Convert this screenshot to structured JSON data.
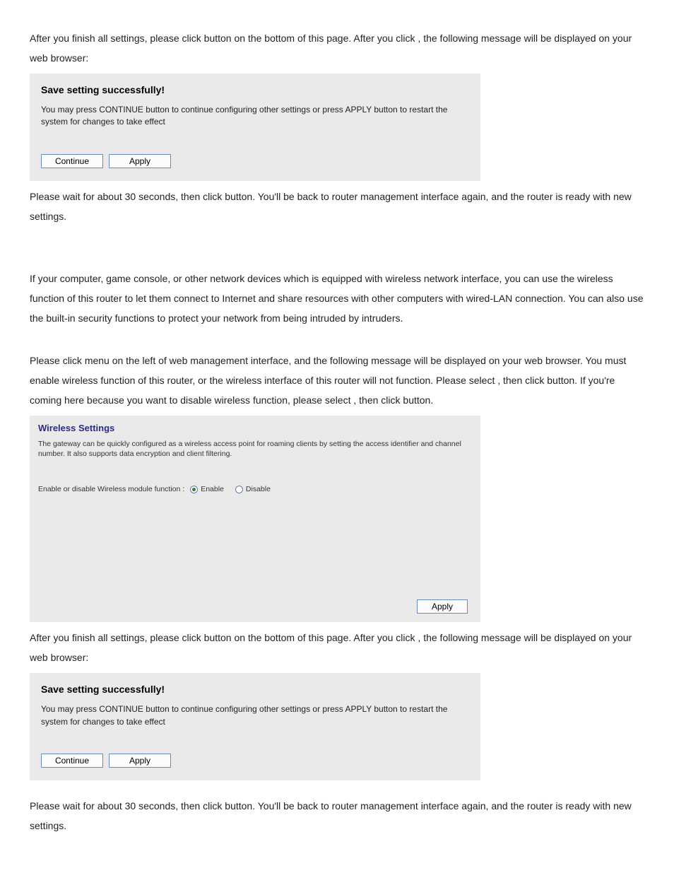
{
  "para1a": "After you finish all settings, please click ",
  "para1b": " button on the bottom of this page. After you click ",
  "para1c": ", the following message will be displayed on your web browser:",
  "dialog1": {
    "title": "Save setting successfully!",
    "desc": "You may press CONTINUE button to continue configuring other settings or press APPLY button to restart the system for changes to take effect",
    "continue": "Continue",
    "apply": "Apply"
  },
  "para2a": "Please wait for about 30 seconds, then click ",
  "para2b": " button. You'll be back to router management interface again, and the router is ready with new settings.",
  "para3": "If your computer, game console, or other network devices which is equipped with wireless network interface, you can use the wireless function of this router to let them connect to Internet and share resources with other computers with wired-LAN connection. You can also use the built-in security functions to protect your network from being intruded by intruders.",
  "para4a": "Please click ",
  "para4b": " menu on the left of web management interface, and the following message will be displayed on your web browser. You must enable wireless function of this router, or the wireless interface of this router will not function. Please select ",
  "para4c": ", then click ",
  "para4d": " button. If you're coming here because you want to disable wireless function, please select ",
  "para4e": ", then click ",
  "para4f": " button.",
  "wireless": {
    "title": "Wireless Settings",
    "desc": "The gateway can be quickly configured as a wireless access point for roaming clients by setting the access identifier and channel number. It also supports data encryption and client filtering.",
    "rowLabel": "Enable or disable Wireless module function :",
    "enable": "Enable",
    "disable": "Disable",
    "apply": "Apply"
  },
  "para5a": "After you finish all settings, please click ",
  "para5b": " button on the bottom of this page. After you click ",
  "para5c": ", the following message will be displayed on your web browser:",
  "dialog2": {
    "title": "Save setting successfully!",
    "desc": "You may press CONTINUE button to continue configuring other settings or press APPLY button to restart the system for changes to take effect",
    "continue": "Continue",
    "apply": "Apply"
  },
  "para6a": "Please wait for about 30 seconds, then click ",
  "para6b": " button. You'll be back to router management interface again, and the router is ready with new settings."
}
